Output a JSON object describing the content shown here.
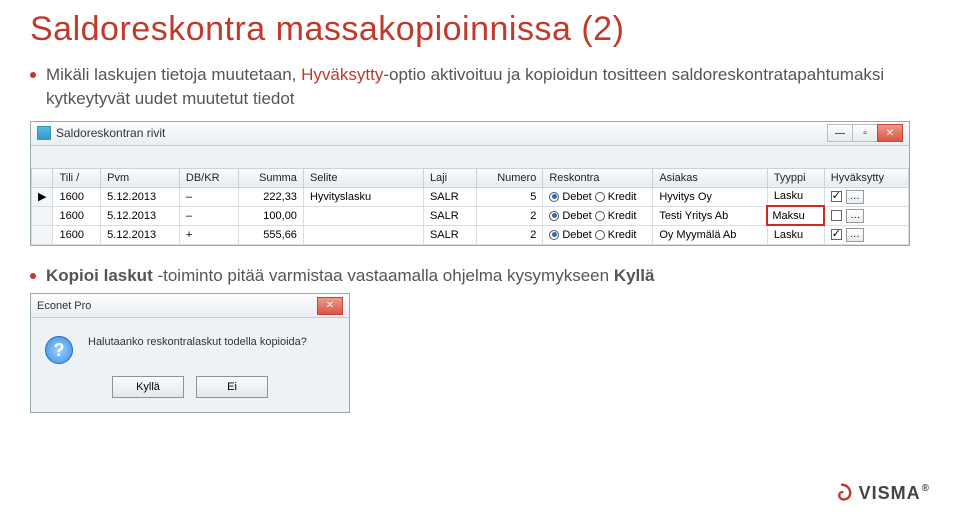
{
  "title": "Saldoreskontra massakopioinnissa (2)",
  "bullet1": {
    "pre": "Mikäli laskujen tietoja muutetaan, ",
    "hl": "Hyväksytty",
    "post": "-optio aktivoituu ja kopioidun tositteen saldoreskontratapahtumaksi kytkeytyvät uudet muutetut tiedot"
  },
  "window1": {
    "title": "Saldoreskontran rivit",
    "columns": [
      "",
      "Tili /",
      "Pvm",
      "DB/KR",
      "Summa",
      "Selite",
      "Laji",
      "Numero",
      "Reskontra",
      "Asiakas",
      "Tyyppi",
      "Hyväksytty"
    ],
    "rows": [
      {
        "ptr": "▶",
        "tili": "1600",
        "pvm": "5.12.2013",
        "dbkr": "–",
        "summa": "222,33",
        "selite": "Hyvityslasku",
        "laji": "SALR",
        "numero": "5",
        "resk": {
          "debet": true,
          "kredit": false
        },
        "asiakas": "Hyvitys Oy",
        "tyyppi": "Lasku",
        "hyv": true
      },
      {
        "ptr": "",
        "tili": "1600",
        "pvm": "5.12.2013",
        "dbkr": "–",
        "summa": "100,00",
        "selite": "",
        "laji": "SALR",
        "numero": "2",
        "resk": {
          "debet": true,
          "kredit": false
        },
        "asiakas": "Testi Yritys Ab",
        "tyyppi": "Maksu",
        "hyv": false,
        "highlight": true
      },
      {
        "ptr": "",
        "tili": "1600",
        "pvm": "5.12.2013",
        "dbkr": "+",
        "summa": "555,66",
        "selite": "",
        "laji": "SALR",
        "numero": "2",
        "resk": {
          "debet": true,
          "kredit": false
        },
        "asiakas": "Oy Myymälä Ab",
        "tyyppi": "Lasku",
        "hyv": true
      }
    ],
    "debet_label": "Debet",
    "kredit_label": "Kredit"
  },
  "bullet2": {
    "pre": "",
    "bold1": "Kopioi laskut",
    "mid": " -toiminto pitää varmistaa vastaamalla ohjelma kysymykseen ",
    "bold2": "Kyllä"
  },
  "dialog": {
    "title": "Econet Pro",
    "text": "Halutaanko reskontralaskut todella kopioida?",
    "yes": "Kyllä",
    "no": "Ei"
  },
  "logo": {
    "text": "VISMA"
  }
}
